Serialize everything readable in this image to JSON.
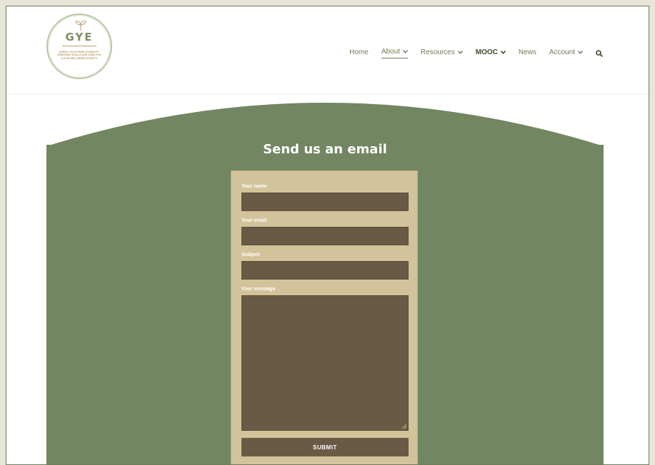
{
  "logo": {
    "title": "GYE",
    "tagline": "GREEN YOUTH EMPLOYABILITY: EMERGING SKILLS AND JOBS FOR A FAIR AND GREEN SOCIETY"
  },
  "nav": {
    "items": [
      {
        "label": "Home",
        "dropdown": false
      },
      {
        "label": "About",
        "dropdown": true,
        "active": true
      },
      {
        "label": "Resources",
        "dropdown": true
      },
      {
        "label": "MOOC",
        "dropdown": true
      },
      {
        "label": "News",
        "dropdown": false
      },
      {
        "label": "Account",
        "dropdown": true
      }
    ],
    "search_icon": "search-icon"
  },
  "contact": {
    "heading": "Send us an email",
    "fields": [
      {
        "label": "Your name",
        "value": ""
      },
      {
        "label": "Your email",
        "value": ""
      },
      {
        "label": "Subject",
        "value": ""
      },
      {
        "label": "Your message",
        "value": ""
      }
    ],
    "submit_label": "SUBMIT"
  },
  "colors": {
    "panel_green": "#728662",
    "form_tan": "#d2c39a",
    "field_brown": "#6a5a45"
  }
}
